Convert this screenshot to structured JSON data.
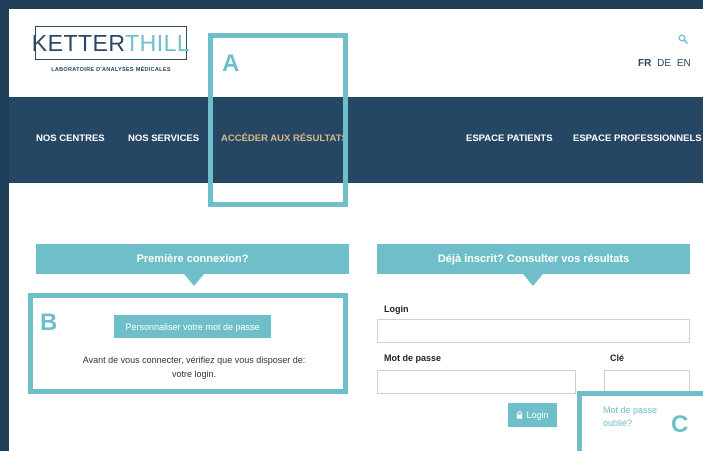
{
  "brand": {
    "name_dark": "KETTER",
    "name_light": "THILL",
    "tagline": "LABORATOIRE D'ANALYSES MÉDICALES"
  },
  "header": {
    "search_icon": "search-icon",
    "languages": [
      {
        "label": "FR",
        "active": true
      },
      {
        "label": "DE",
        "active": false
      },
      {
        "label": "EN",
        "active": false
      }
    ]
  },
  "nav": {
    "items": [
      {
        "label": "NOS CENTRES"
      },
      {
        "label": "NOS SERVICES"
      },
      {
        "label": "ACCÉDER AUX RÉSULTATS",
        "active": true
      },
      {
        "label": "ESPACE PATIENTS"
      },
      {
        "label": "ESPACE PROFESSIONNELS"
      }
    ]
  },
  "first_login": {
    "title": "Première connexion?",
    "button": "Personnaliser votre mot de passe",
    "info_line1": "Avant de vous connecter, vérifiez que vous disposer de:",
    "info_line2": "votre login."
  },
  "registered": {
    "title": "Déjà inscrit? Consulter vos résultats",
    "login_label": "Login",
    "password_label": "Mot de passe",
    "key_label": "Clé",
    "login_button": "Login",
    "forgot_line1": "Mot de passe",
    "forgot_line2": "oublié?"
  },
  "annotations": {
    "a": "A",
    "b": "B",
    "c": "C"
  },
  "colors": {
    "navy": "#254763",
    "teal": "#6fbfca",
    "gold": "#d7b98a"
  }
}
